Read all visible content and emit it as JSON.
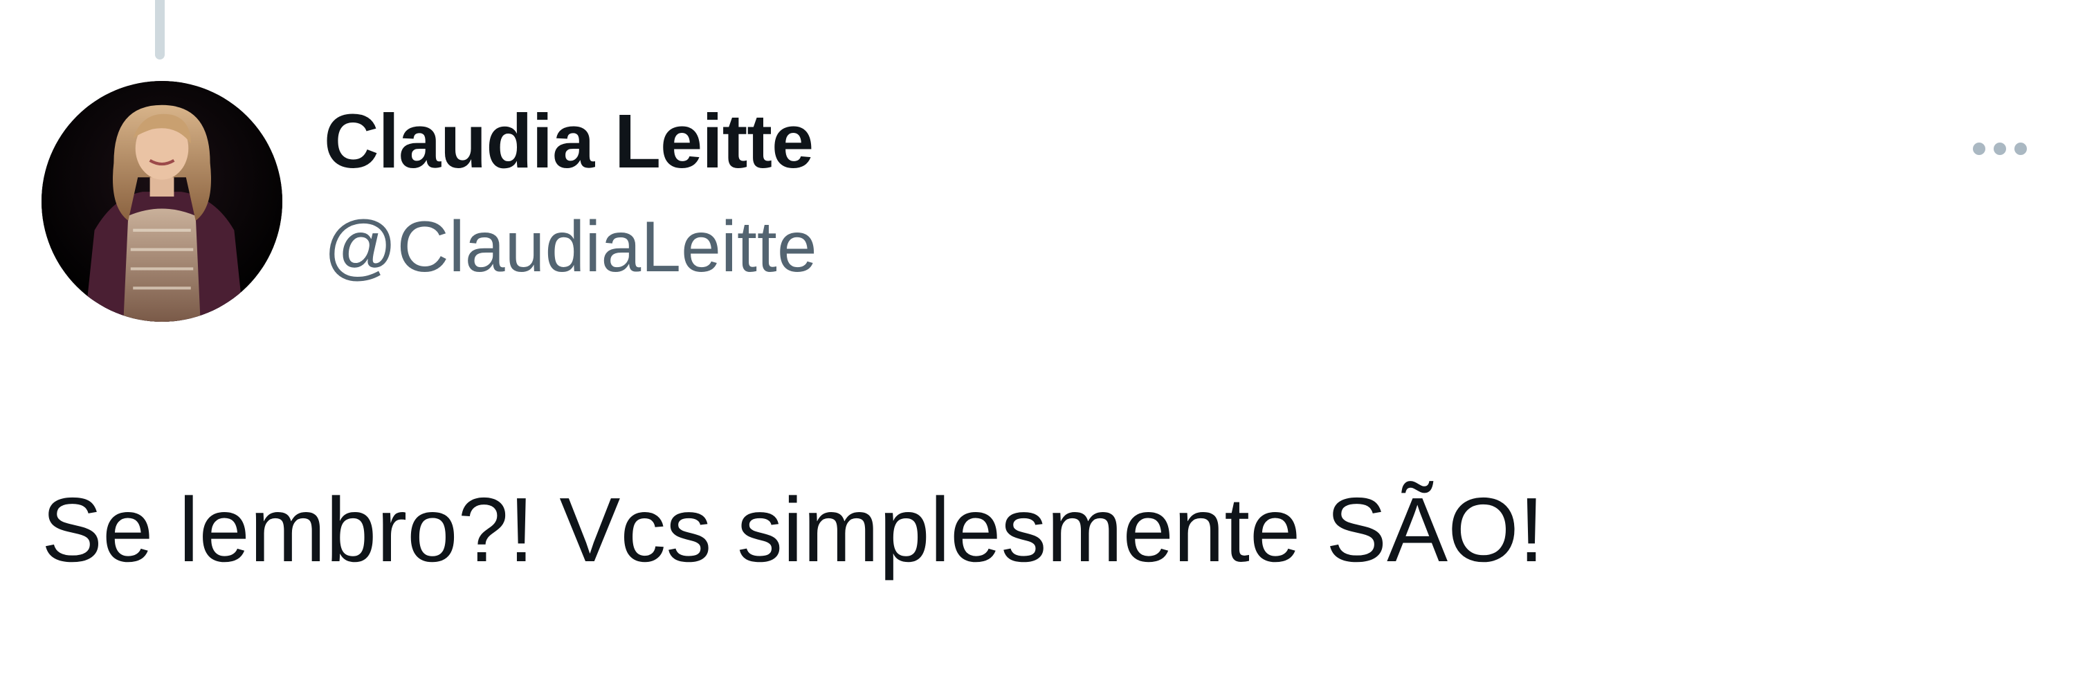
{
  "tweet": {
    "author": {
      "display_name": "Claudia Leitte",
      "handle": "@ClaudiaLeitte",
      "avatar_icon": "profile-photo"
    },
    "text": "Se lembro?! Vcs simplesmente SÃO!",
    "more_icon": "ellipsis-icon"
  },
  "colors": {
    "text_primary": "#0f1419",
    "text_secondary": "#536471",
    "thread_line": "#cfd9de",
    "more_dots": "#aab8c2"
  }
}
